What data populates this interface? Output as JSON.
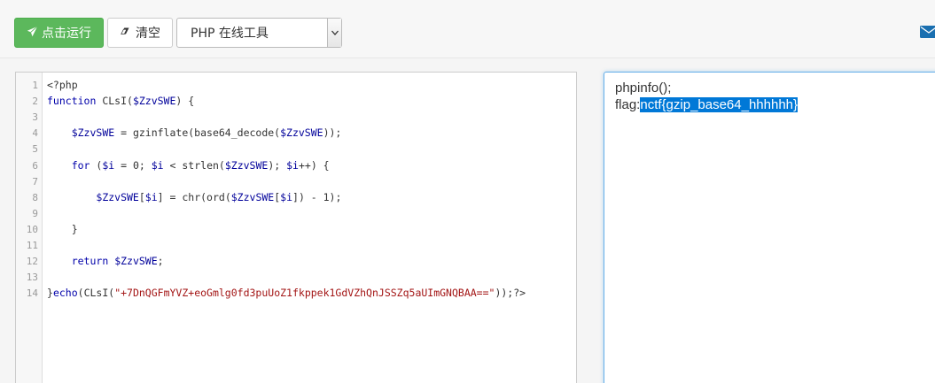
{
  "toolbar": {
    "run_label": "点击运行",
    "clear_label": "清空",
    "select_value": "PHP 在线工具"
  },
  "editor": {
    "lines": [
      {
        "n": "1",
        "code": "<?php"
      },
      {
        "n": "2",
        "code": "function CLsI($ZzvSWE) {"
      },
      {
        "n": "3",
        "code": ""
      },
      {
        "n": "4",
        "code": "    $ZzvSWE = gzinflate(base64_decode($ZzvSWE));"
      },
      {
        "n": "5",
        "code": ""
      },
      {
        "n": "6",
        "code": "    for ($i = 0; $i < strlen($ZzvSWE); $i++) {"
      },
      {
        "n": "7",
        "code": ""
      },
      {
        "n": "8",
        "code": "        $ZzvSWE[$i] = chr(ord($ZzvSWE[$i]) - 1);"
      },
      {
        "n": "9",
        "code": ""
      },
      {
        "n": "10",
        "code": "    }"
      },
      {
        "n": "11",
        "code": ""
      },
      {
        "n": "12",
        "code": "    return $ZzvSWE;"
      },
      {
        "n": "13",
        "code": ""
      },
      {
        "n": "14",
        "code": "}echo(CLsI(\"+7DnQGFmYVZ+eoGmlg0fd3puUoZ1fkppek1GdVZhQnJSSZq5aUImGNQBAA==\"));?>"
      }
    ]
  },
  "output": {
    "line1": "phpinfo();",
    "flag_prefix": "flag:",
    "flag_value": "nctf{gzip_base64_hhhhhh}"
  },
  "colors": {
    "run_button": "#5cb85c",
    "selection": "#0078d7",
    "focus_border": "#66afe9"
  },
  "icons": {
    "run": "paper-plane-icon",
    "clear": "eraser-icon",
    "mail": "envelope-icon"
  }
}
